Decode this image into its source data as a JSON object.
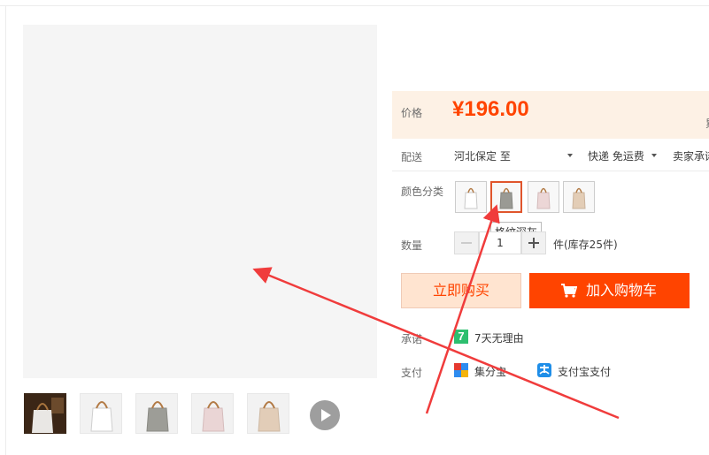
{
  "price": {
    "label": "价格",
    "value": "¥196.00",
    "edge_char": "累"
  },
  "shipping": {
    "label": "配送",
    "destination": "河北保定 至",
    "method": "快递 免运费",
    "promise": "卖家承诺"
  },
  "color": {
    "label": "颜色分类",
    "options": [
      "白色",
      "格纹深灰",
      "粉色",
      "米色"
    ],
    "selected": "格纹深灰",
    "tooltip": "格纹深灰"
  },
  "quantity": {
    "label": "数量",
    "value": "1",
    "stock": "件(库存25件)"
  },
  "buttons": {
    "buy_now": "立即购买",
    "add_cart": "加入购物车"
  },
  "service": {
    "label": "承诺",
    "icon_char": "7",
    "text": "7天无理由"
  },
  "payment": {
    "label": "支付",
    "method1": "集分宝",
    "method2": "支付宝支付"
  },
  "colors": {
    "accent": "#ff4400",
    "price_bg": "#fdf1e5",
    "arrow": "#f03c3c"
  }
}
